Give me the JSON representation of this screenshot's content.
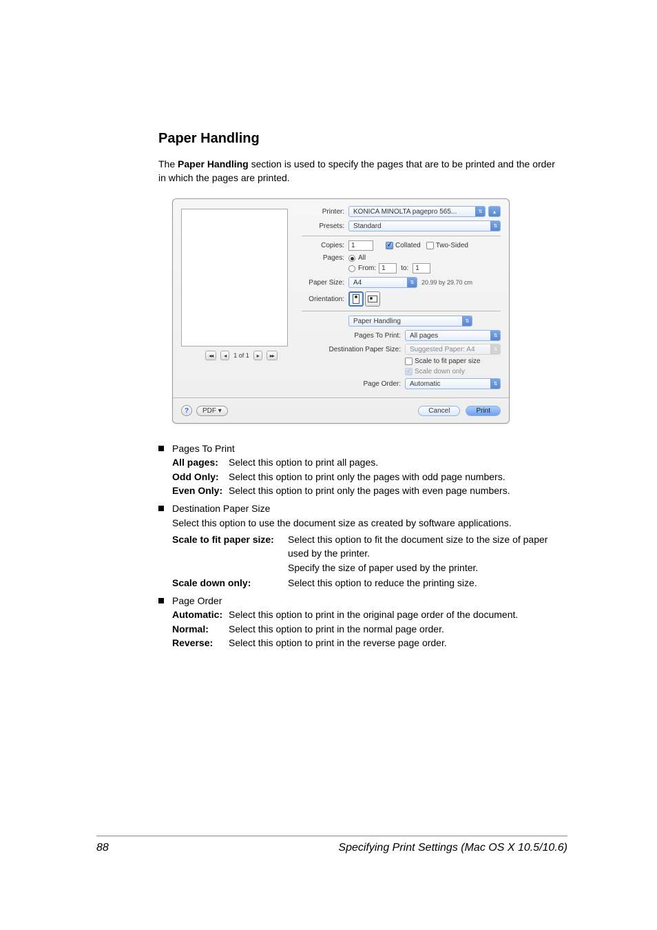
{
  "heading": "Paper Handling",
  "intro": "The Paper Handling section is used to specify the pages that are to be printed and the order in which the pages are printed.",
  "dialog": {
    "printer_label": "Printer:",
    "printer_value": "KONICA MINOLTA pagepro 565...",
    "presets_label": "Presets:",
    "presets_value": "Standard",
    "copies_label": "Copies:",
    "copies_value": "1",
    "collated_label": "Collated",
    "twosided_label": "Two-Sided",
    "pages_label": "Pages:",
    "pages_all": "All",
    "pages_from": "From:",
    "from_val": "1",
    "to_label": "to:",
    "to_val": "1",
    "papersize_label": "Paper Size:",
    "papersize_value": "A4",
    "papersize_dims": "20.99 by 29.70 cm",
    "orientation_label": "Orientation:",
    "pane_label": "Paper Handling",
    "ptp_label": "Pages To Print:",
    "ptp_value": "All pages",
    "dps_label": "Destination Paper Size:",
    "dps_value": "Suggested Paper: A4",
    "scalefit_label": "Scale to fit paper size",
    "scaledown_label": "Scale down only",
    "pageorder_label": "Page Order:",
    "pageorder_value": "Automatic",
    "nav_counter": "1 of 1",
    "pdf_label": "PDF ▾",
    "cancel": "Cancel",
    "print": "Print"
  },
  "options": {
    "ptp_title": "Pages To Print",
    "ptp_all_term": "All pages:",
    "ptp_all_desc": "Select this option to print all pages.",
    "ptp_odd_term": "Odd Only:",
    "ptp_odd_desc": "Select this option to print only the pages with odd page numbers.",
    "ptp_even_term": "Even Only:",
    "ptp_even_desc": "Select this option to print only the pages with even page numbers.",
    "dps_title": "Destination Paper Size",
    "dps_intro": "Select this option to use the document size as created by software applications.",
    "dps_scalefit_term": "Scale to fit paper size:",
    "dps_scalefit_desc": "Select this option to fit the document size to the size of paper used by the printer.",
    "dps_scalefit_note": "Specify the size of paper used by the printer.",
    "dps_scaledown_term": "Scale down only:",
    "dps_scaledown_desc": "Select this option to reduce the printing size.",
    "po_title": "Page Order",
    "po_auto_term": "Automatic:",
    "po_auto_desc": "Select this option to print in the original page order of the document.",
    "po_normal_term": "Normal:",
    "po_normal_desc": "Select this option to print in the normal page order.",
    "po_reverse_term": "Reverse:",
    "po_reverse_desc": "Select this option to print in the reverse page order."
  },
  "footer": {
    "page_number": "88",
    "title": "Specifying Print Settings (Mac OS X 10.5/10.6)"
  }
}
